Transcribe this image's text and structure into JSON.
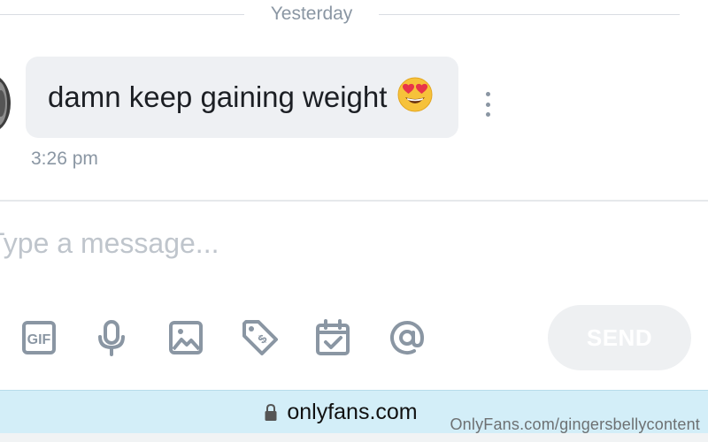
{
  "thread": {
    "date_divider": "Yesterday",
    "message": {
      "text": "damn keep gaining weight",
      "emoji": "heart-eyes-emoji",
      "time": "3:26 pm"
    }
  },
  "composer": {
    "placeholder": "Type a message...",
    "toolbar": [
      "gif-icon",
      "microphone-icon",
      "image-icon",
      "price-tag-icon",
      "calendar-icon",
      "mention-icon"
    ],
    "send_label": "SEND"
  },
  "browser": {
    "url": "onlyfans.com"
  },
  "watermark": "OnlyFans.com/gingersbellycontent",
  "colors": {
    "muted_text": "#8a96a3",
    "bubble_bg": "#eef0f3",
    "url_bar_bg": "#d3eef8"
  }
}
